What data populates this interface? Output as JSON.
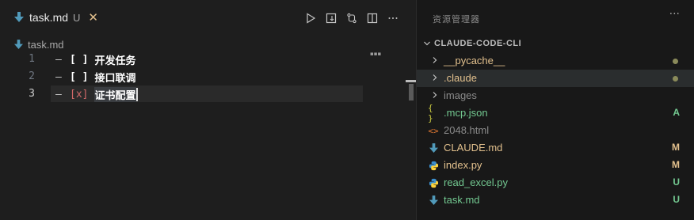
{
  "colors": {
    "modified": "#e2c08d",
    "untracked": "#73c991",
    "muted_label": "#8a8a8a",
    "checked_box": "#d16969",
    "folder_dot": "#8a8a5a",
    "markdown_icon": "#519aba",
    "python_icon": "#3b8fce",
    "json_icon": "#cbcb41",
    "html_icon": "#e37933"
  },
  "tab": {
    "icon": "markdown-arrow-icon",
    "label": "task.md",
    "badge": "U",
    "close": "✕"
  },
  "toolbar": {
    "icons": [
      "run-icon",
      "open-preview-icon",
      "git-compare-icon",
      "split-editor-icon",
      "more-actions-icon"
    ]
  },
  "breadcrumb": {
    "label": "task.md"
  },
  "editor": {
    "lines": [
      {
        "number": "1",
        "dash": "–",
        "box": "[ ]",
        "text": "开发任务",
        "checked": false
      },
      {
        "number": "2",
        "dash": "–",
        "box": "[ ]",
        "text": "接口联调",
        "checked": false
      },
      {
        "number": "3",
        "dash": "–",
        "box": "[x]",
        "text": "证书配置",
        "checked": true
      }
    ],
    "active_line": 3
  },
  "explorer": {
    "title": "资源管理器",
    "more": "···",
    "section": "CLAUDE-CODE-CLI",
    "items": [
      {
        "label": "__pycache__",
        "kind": "folder",
        "icon": "chevron-right-icon",
        "color": "#e2c08d",
        "indicator": "dot",
        "status": ""
      },
      {
        "label": ".claude",
        "kind": "folder",
        "icon": "chevron-right-icon",
        "color": "#e2c08d",
        "indicator": "dot",
        "status": "",
        "highlighted": true
      },
      {
        "label": "images",
        "kind": "folder",
        "icon": "chevron-right-icon",
        "color": "#8a8a8a",
        "indicator": "",
        "status": ""
      },
      {
        "label": ".mcp.json",
        "kind": "file",
        "icon": "json-braces-icon",
        "glyph": "{ }",
        "color": "#73c991",
        "indicator": "",
        "status": "A"
      },
      {
        "label": "2048.html",
        "kind": "file",
        "icon": "html-brackets-icon",
        "glyph": "<>",
        "color": "#8a8a8a",
        "indicator": "",
        "status": ""
      },
      {
        "label": "CLAUDE.md",
        "kind": "file",
        "icon": "markdown-arrow-icon",
        "glyph": "",
        "color": "#e2c08d",
        "indicator": "",
        "status": "M"
      },
      {
        "label": "index.py",
        "kind": "file",
        "icon": "python-icon",
        "glyph": "",
        "color": "#e2c08d",
        "indicator": "",
        "status": "M"
      },
      {
        "label": "read_excel.py",
        "kind": "file",
        "icon": "python-icon",
        "glyph": "",
        "color": "#73c991",
        "indicator": "",
        "status": "U"
      },
      {
        "label": "task.md",
        "kind": "file",
        "icon": "markdown-arrow-icon",
        "glyph": "",
        "color": "#73c991",
        "indicator": "",
        "status": "U"
      }
    ]
  }
}
